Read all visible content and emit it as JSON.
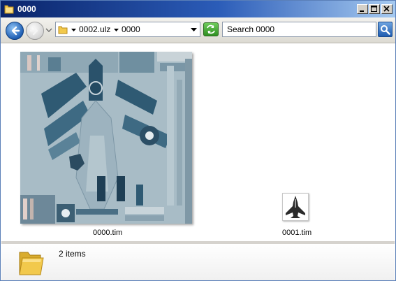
{
  "window": {
    "title": "0000"
  },
  "toolbar": {
    "address": {
      "segments": [
        "0002.ulz",
        "0000"
      ]
    },
    "search": {
      "placeholder": "Search 0000"
    }
  },
  "files": [
    {
      "name": "0000.tim"
    },
    {
      "name": "0001.tim"
    }
  ],
  "details": {
    "item_count": "2 items"
  },
  "colors": {
    "titlebar_start": "#0a246a",
    "titlebar_end": "#a6caf0",
    "folder_yellow": "#f2c94c",
    "texture_base": "#a8bcc6",
    "texture_dark": "#2f5a73"
  },
  "icons": {
    "back": "back-arrow-icon",
    "forward": "forward-arrow-icon",
    "refresh": "refresh-icon",
    "search": "search-icon",
    "folder": "folder-icon"
  }
}
